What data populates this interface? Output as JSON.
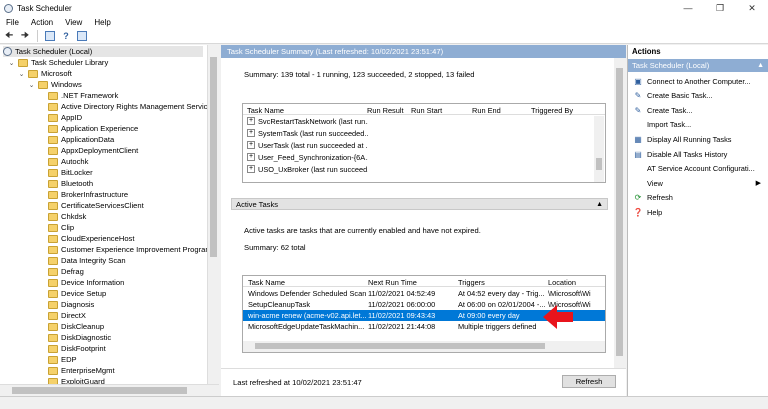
{
  "window": {
    "title": "Task Scheduler"
  },
  "menu": [
    "File",
    "Action",
    "View",
    "Help"
  ],
  "tree": {
    "root": "Task Scheduler (Local)",
    "library": "Task Scheduler Library",
    "microsoft": "Microsoft",
    "windows": "Windows",
    "items": [
      ".NET Framework",
      "Active Directory Rights Management Services Cl",
      "AppID",
      "Application Experience",
      "ApplicationData",
      "AppxDeploymentClient",
      "Autochk",
      "BitLocker",
      "Bluetooth",
      "BrokerInfrastructure",
      "CertificateServicesClient",
      "Chkdsk",
      "Clip",
      "CloudExperienceHost",
      "Customer Experience Improvement Program",
      "Data Integrity Scan",
      "Defrag",
      "Device Information",
      "Device Setup",
      "Diagnosis",
      "DirectX",
      "DiskCleanup",
      "DiskDiagnostic",
      "DiskFootprint",
      "EDP",
      "EnterpriseMgmt",
      "ExploitGuard"
    ]
  },
  "center": {
    "header": "Task Scheduler Summary (Last refreshed: 10/02/2021 23:51:47)",
    "summary": "Summary: 139 total - 1 running, 123 succeeded, 2 stopped, 13 failed",
    "status_table": {
      "columns": [
        "Task Name",
        "Run Result",
        "Run Start",
        "Run End",
        "Triggered By"
      ],
      "rows": [
        "SvcRestartTaskNetwork (last run...",
        "SystemTask (last run succeeded...",
        "UserTask (last run succeeded at ...",
        "User_Feed_Synchronization-{6A...",
        "USO_UxBroker (last run succeed..."
      ]
    },
    "active_tasks": {
      "title": "Active Tasks",
      "description": "Active tasks are tasks that are currently enabled and have not expired.",
      "summary": "Summary: 62 total",
      "columns": [
        "Task Name",
        "Next Run Time",
        "Triggers",
        "Location"
      ],
      "rows": [
        {
          "name": "Windows Defender Scheduled Scan",
          "next": "11/02/2021 04:52:49",
          "trigger": "At 04:52 every day - Trig...",
          "location": "\\Microsoft\\Wi"
        },
        {
          "name": "SetupCleanupTask",
          "next": "11/02/2021 06:00:00",
          "trigger": "At 06:00 on 02/01/2004 -...",
          "location": "\\Microsoft\\Wi"
        },
        {
          "name": "win-acme renew (acme-v02.api.let...",
          "next": "11/02/2021 09:43:43",
          "trigger": "At 09:00 every day",
          "location": ""
        },
        {
          "name": "MicrosoftEdgeUpdateTaskMachin...",
          "next": "11/02/2021 21:44:08",
          "trigger": "Multiple triggers defined",
          "location": ""
        },
        {
          "name": "",
          "next": "",
          "trigger": "",
          "location": ""
        }
      ]
    },
    "last_refreshed": "Last refreshed at 10/02/2021 23:51:47",
    "refresh_button": "Refresh"
  },
  "actions": {
    "title": "Actions",
    "section": "Task Scheduler (Local)",
    "items": [
      {
        "label": "Connect to Another Computer...",
        "icon": "computer-icon"
      },
      {
        "label": "Create Basic Task...",
        "icon": "create-basic-task-icon"
      },
      {
        "label": "Create Task...",
        "icon": "create-task-icon"
      },
      {
        "label": "Import Task...",
        "icon": "import-icon"
      },
      {
        "label": "Display All Running Tasks",
        "icon": "running-tasks-icon"
      },
      {
        "label": "Disable All Tasks History",
        "icon": "history-icon"
      },
      {
        "label": "AT Service Account Configurati...",
        "icon": "account-icon"
      },
      {
        "label": "View",
        "icon": "view-icon"
      },
      {
        "label": "Refresh",
        "icon": "refresh-icon"
      },
      {
        "label": "Help",
        "icon": "help-icon"
      }
    ]
  },
  "colors": {
    "header_blue": "#8eadd3",
    "selection": "#0078d7",
    "arrow_red": "#e8141c"
  }
}
